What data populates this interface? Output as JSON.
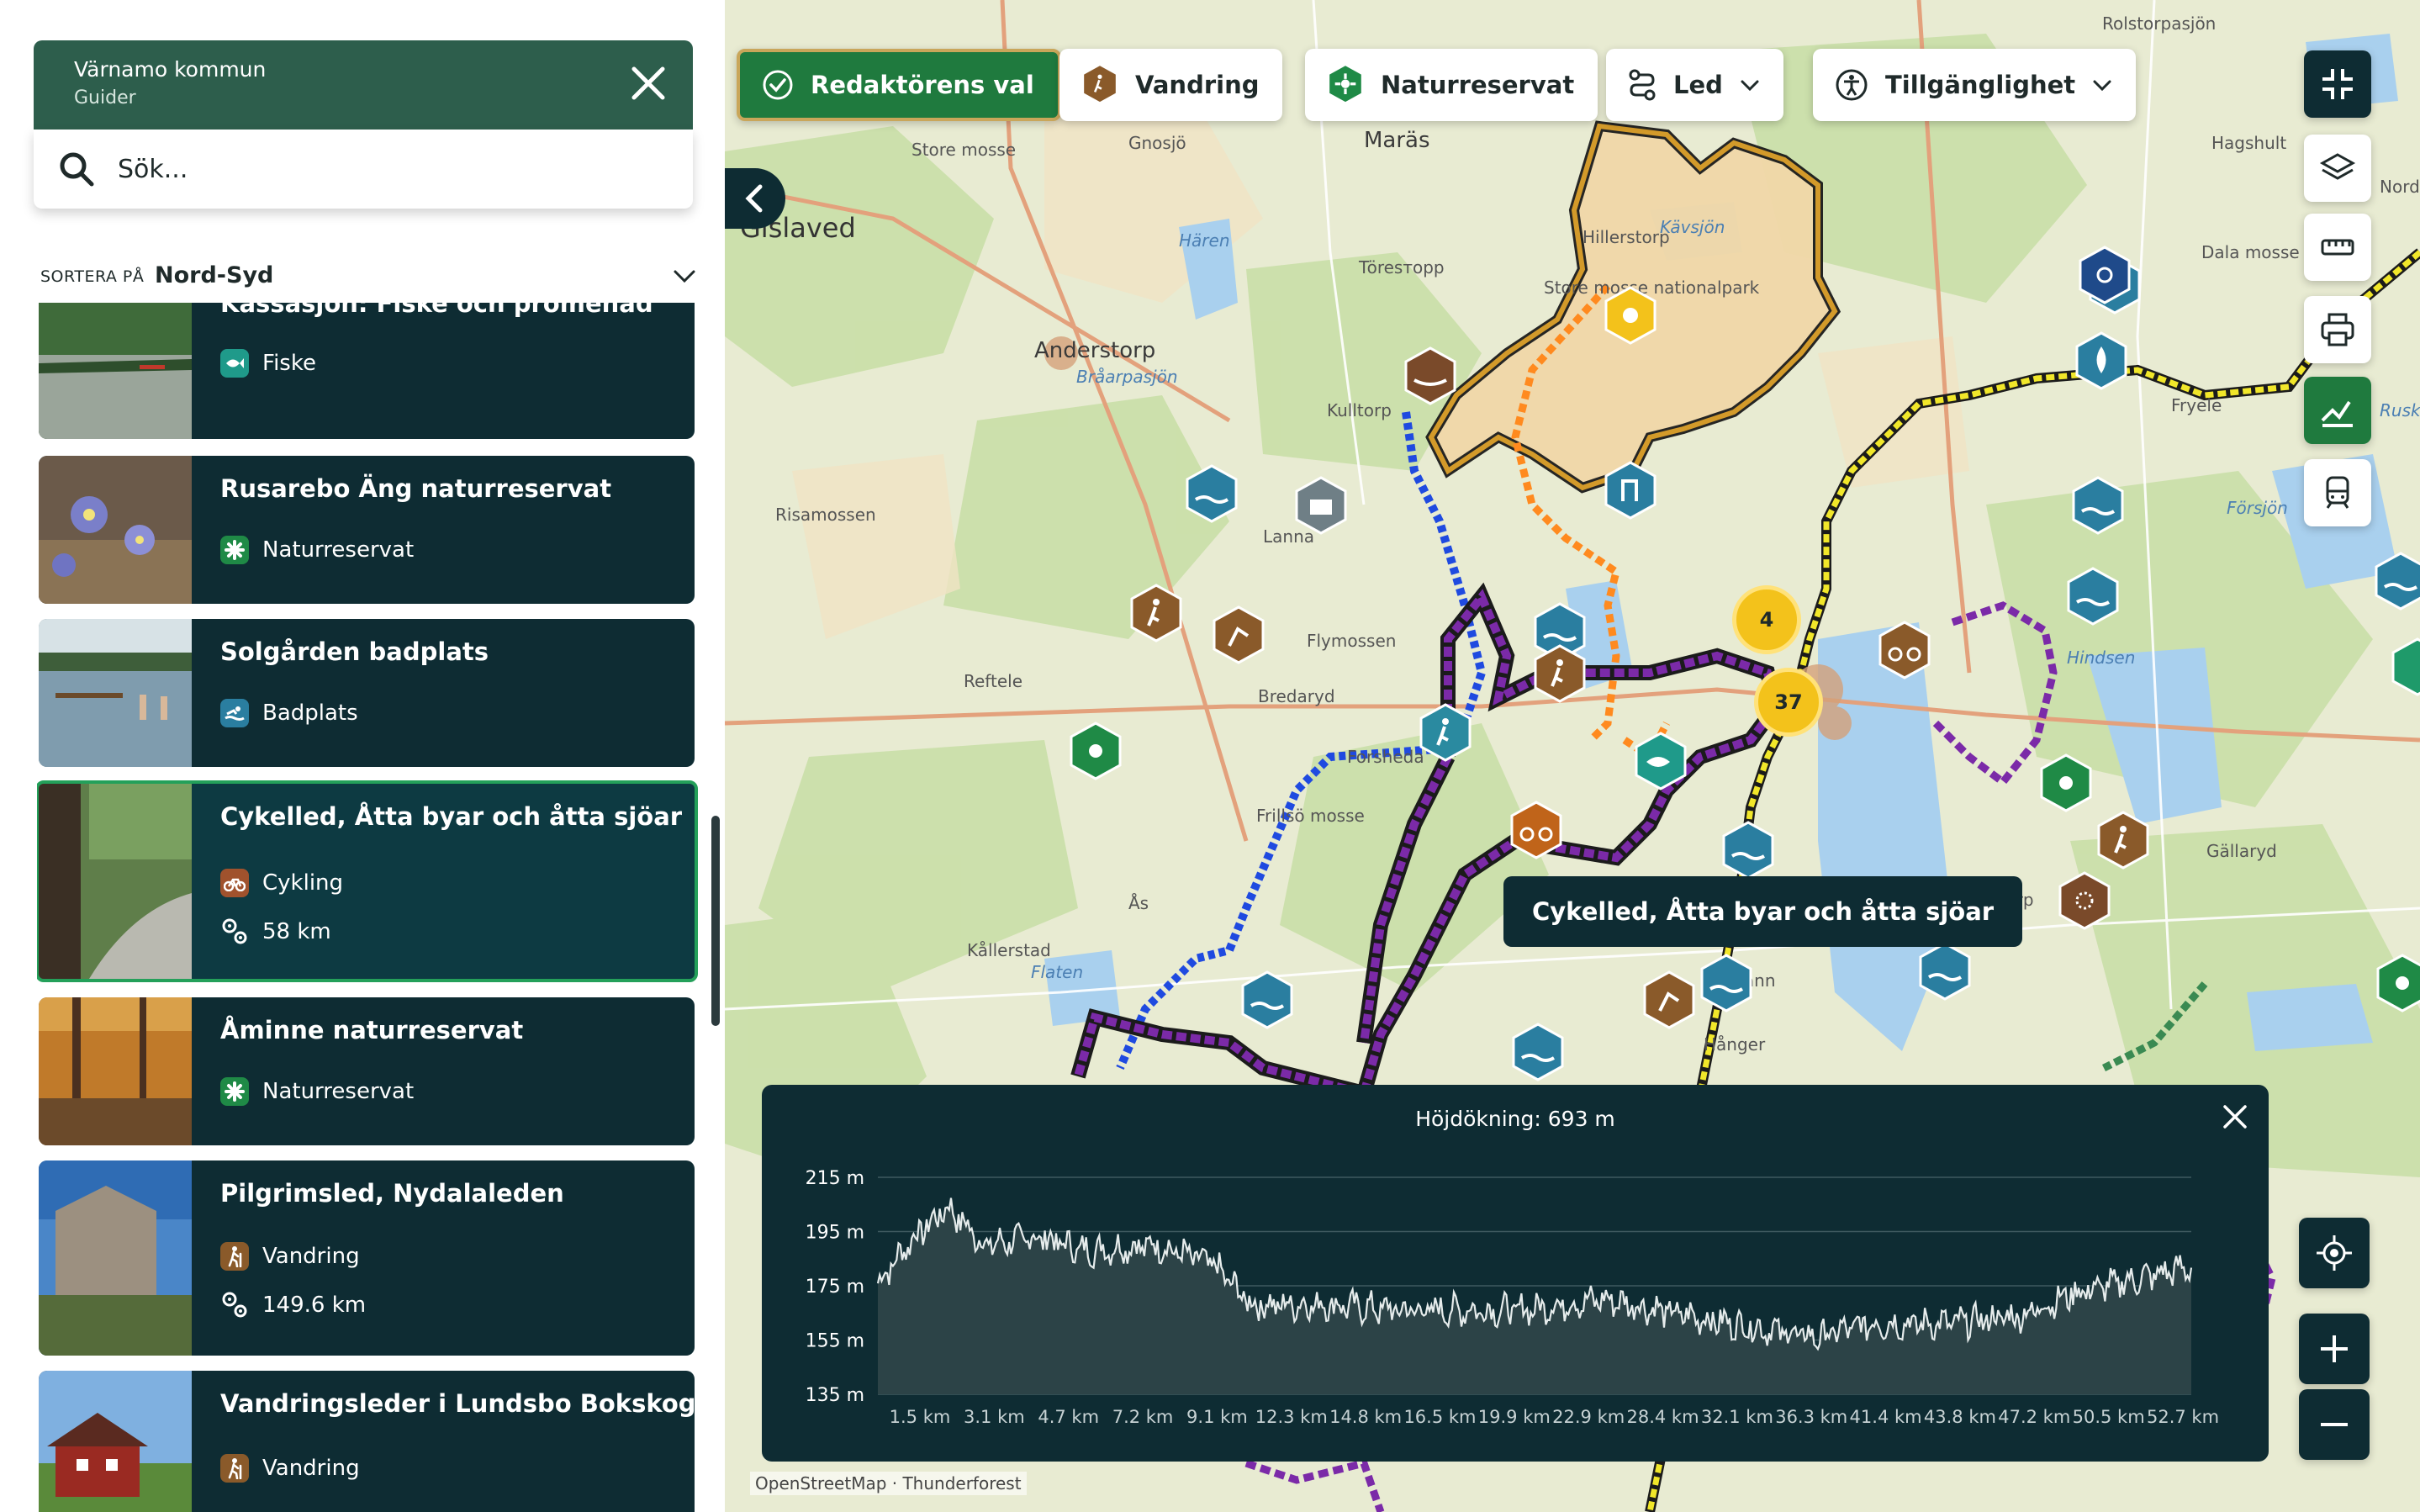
{
  "sidebar": {
    "header": {
      "title": "Värnamo kommun",
      "subtitle": "Guider"
    },
    "search": {
      "placeholder": "Sök..."
    },
    "sort": {
      "label": "SORTERA PÅ",
      "value": "Nord-Syd"
    },
    "items": [
      {
        "title": "Kassasjön: Fiske och promenad",
        "category": "Fiske",
        "icon": "fish-icon",
        "color": "#1f9a8a"
      },
      {
        "title": "Rusarebo Äng naturreservat",
        "category": "Naturreservat",
        "icon": "nature-reserve-icon",
        "color": "#1f8a46"
      },
      {
        "title": "Solgården badplats",
        "category": "Badplats",
        "icon": "swimming-icon",
        "color": "#2a7ea0"
      },
      {
        "title": "Cykelled, Åtta byar och åtta sjöar",
        "category": "Cykling",
        "icon": "cycling-icon",
        "color": "#a0522d",
        "distance": "58 km",
        "selected": true
      },
      {
        "title": "Åminne naturreservat",
        "category": "Naturreservat",
        "icon": "nature-reserve-icon",
        "color": "#1f8a46"
      },
      {
        "title": "Pilgrimsled, Nydalaleden",
        "category": "Vandring",
        "icon": "hiking-icon",
        "color": "#8a5a2a",
        "distance": "149.6 km"
      },
      {
        "title": "Vandringsleder i Lundsbo Bokskog",
        "category": "Vandring",
        "icon": "hiking-icon",
        "color": "#8a5a2a"
      }
    ]
  },
  "filters": [
    {
      "label": "Redaktörens val",
      "icon": "check-circle-icon",
      "active": true
    },
    {
      "label": "Vandring",
      "icon": "hiking-icon"
    },
    {
      "label": "Naturreservat",
      "icon": "nature-reserve-icon"
    },
    {
      "label": "Led",
      "icon": "route-icon",
      "dropdown": true
    },
    {
      "label": "Tillgänglighet",
      "icon": "accessibility-icon",
      "dropdown": true
    }
  ],
  "map": {
    "places": [
      "Gislaved",
      "Anderstorp",
      "Maräs",
      "Hillerstorp",
      "Töresторp",
      "Kulltorp",
      "Lanna",
      "Reftele",
      "Bredaryd",
      "Forsheda",
      "Kållerstad",
      "Ås",
      "Hagshult",
      "Fryele",
      "Försjön",
      "Hindsen",
      "Gällaryd",
      "Voxtorp",
      "Tånn",
      "Hånger",
      "Flymossen",
      "Frillsö mosse",
      "Flaten",
      "Store mosse",
      "Gnosjö",
      "Rolstorpasjön",
      "Kävsjön",
      "Store mosse nationalpark",
      "Hären",
      "Risamossen",
      "Bråarpasjön",
      "Dala mosse",
      "Nord",
      "Rusk"
    ],
    "clusters": [
      {
        "count": "4"
      },
      {
        "count": "37"
      }
    ],
    "tooltip": "Cykelled, Åtta byar och åtta sjöar",
    "attribution": "OpenStreetMap · Thunderforest"
  },
  "elevation": {
    "title": "Höjdökning: 693 m",
    "y_ticks": [
      "215 m",
      "195 m",
      "175 m",
      "155 m",
      "135 m"
    ],
    "x_ticks": [
      "1.5 km",
      "3.1 km",
      "4.7 km",
      "7.2 km",
      "9.1 km",
      "12.3 km",
      "14.8 km",
      "16.5 km",
      "19.9 km",
      "22.9 km",
      "28.4 km",
      "32.1 km",
      "36.3 km",
      "41.4 km",
      "43.8 km",
      "47.2 km",
      "50.5 km",
      "52.7 km"
    ]
  },
  "chart_data": {
    "type": "area",
    "title": "Höjdökning: 693 m",
    "xlabel": "",
    "ylabel": "",
    "ylim": [
      135,
      215
    ],
    "x_unit": "km",
    "y_unit": "m",
    "x": [
      0,
      1.5,
      3.1,
      4.7,
      7.2,
      9.1,
      12.3,
      14.8,
      16.5,
      19.9,
      22.9,
      28.4,
      32.1,
      36.3,
      41.4,
      43.8,
      47.2,
      50.5,
      52.7,
      58
    ],
    "values": [
      176,
      192,
      204,
      190,
      193,
      188,
      190,
      183,
      168,
      168,
      166,
      166,
      170,
      163,
      156,
      161,
      161,
      164,
      172,
      182
    ]
  }
}
